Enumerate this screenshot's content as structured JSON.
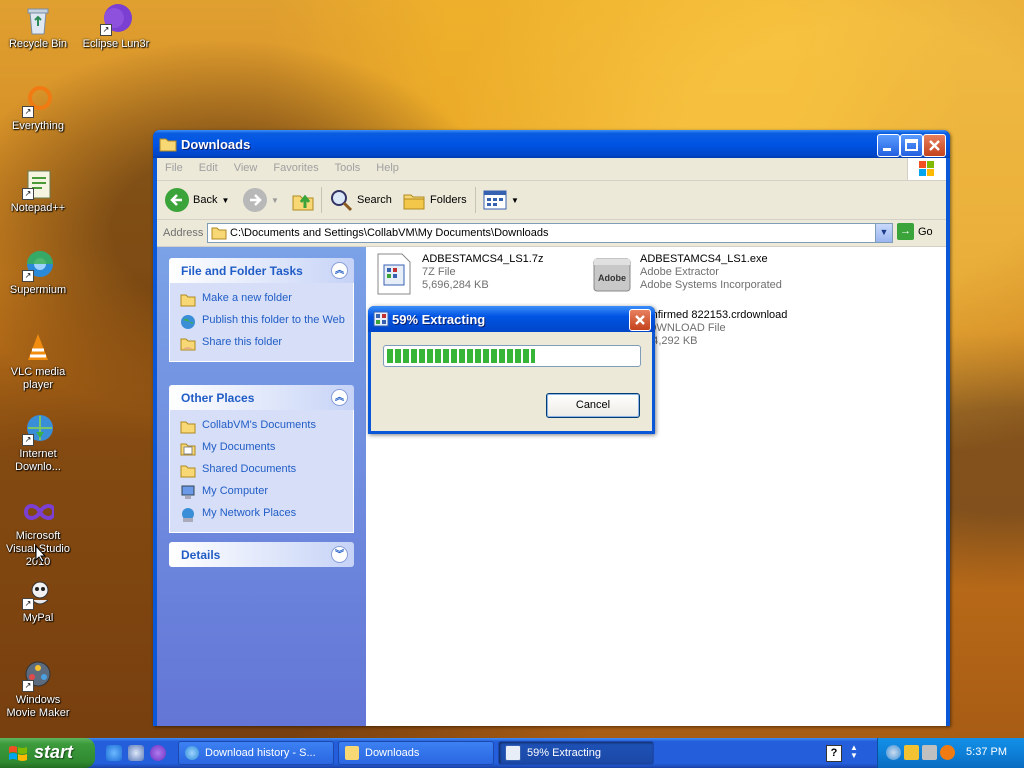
{
  "desktop": {
    "icons": [
      {
        "label": "Recycle Bin"
      },
      {
        "label": "Eclipse Lun3r"
      },
      {
        "label": "Everything"
      },
      {
        "label": "Notepad++"
      },
      {
        "label": "Supermium"
      },
      {
        "label": "VLC media player"
      },
      {
        "label": "Internet Downlo..."
      },
      {
        "label": "Microsoft Visual Studio 2010"
      },
      {
        "label": "MyPal"
      },
      {
        "label": "Windows Movie Maker"
      }
    ]
  },
  "window": {
    "title": "Downloads",
    "menu": [
      "File",
      "Edit",
      "View",
      "Favorites",
      "Tools",
      "Help"
    ],
    "toolbar": {
      "back": "Back",
      "search": "Search",
      "folders": "Folders"
    },
    "address": {
      "label": "Address",
      "value": "C:\\Documents and Settings\\CollabVM\\My Documents\\Downloads",
      "go": "Go"
    },
    "taskpane": {
      "file_tasks": {
        "title": "File and Folder Tasks",
        "items": [
          "Make a new folder",
          "Publish this folder to the Web",
          "Share this folder"
        ]
      },
      "other_places": {
        "title": "Other Places",
        "items": [
          "CollabVM's Documents",
          "My Documents",
          "Shared Documents",
          "My Computer",
          "My Network Places"
        ]
      },
      "details": {
        "title": "Details"
      }
    },
    "files": [
      {
        "name": "ADBESTAMCS4_LS1.7z",
        "type": "7Z File",
        "size": "5,696,284 KB"
      },
      {
        "name": "ADBESTAMCS4_LS1.exe",
        "type": "Adobe Extractor",
        "size": "Adobe Systems Incorporated"
      },
      {
        "name": "confirmed 822153.crdownload",
        "type": "DOWNLOAD File",
        "size": "924,292 KB"
      }
    ]
  },
  "dialog": {
    "title": "59% Extracting",
    "progress": 0.59,
    "cancel": "Cancel"
  },
  "taskbar": {
    "start": "start",
    "tasks": [
      "Download history - S...",
      "Downloads",
      "59% Extracting"
    ],
    "clock": "5:37 PM"
  },
  "colors": {
    "xp_blue": "#0054e3",
    "link_blue": "#215dc6",
    "progress_green": "#37b537",
    "start_green": "#3c9a3c"
  }
}
